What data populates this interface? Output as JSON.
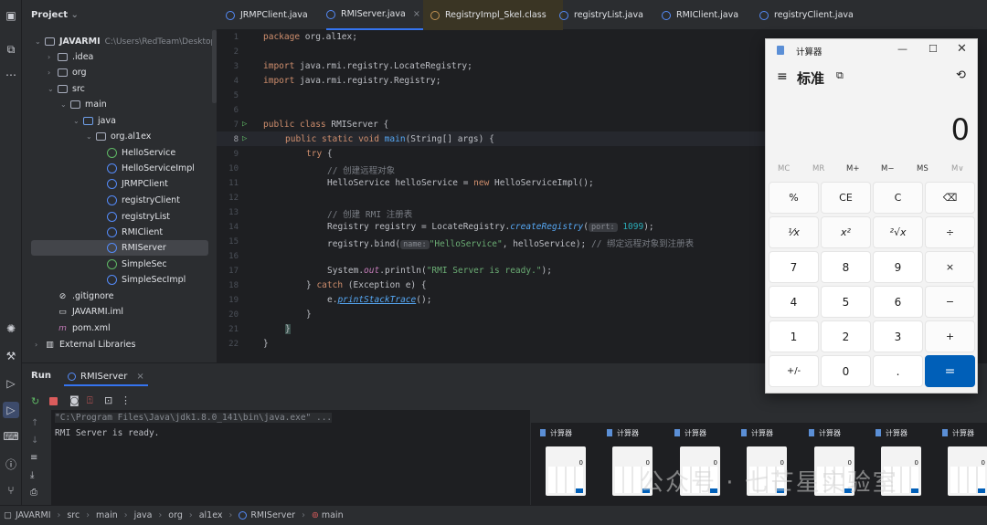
{
  "project": {
    "header": "Project",
    "tree": [
      {
        "label": "JAVARMI",
        "sub": "C:\\Users\\RedTeam\\Desktop\\De",
        "kind": "folder"
      },
      {
        "label": ".idea",
        "kind": "folder"
      },
      {
        "label": "org",
        "kind": "folder"
      },
      {
        "label": "src",
        "kind": "folder"
      },
      {
        "label": "main",
        "kind": "folder"
      },
      {
        "label": "java",
        "kind": "folder"
      },
      {
        "label": "org.al1ex",
        "kind": "package"
      },
      {
        "label": "HelloService",
        "kind": "class"
      },
      {
        "label": "HelloServiceImpl",
        "kind": "class"
      },
      {
        "label": "JRMPClient",
        "kind": "class"
      },
      {
        "label": "registryClient",
        "kind": "class"
      },
      {
        "label": "registryList",
        "kind": "class"
      },
      {
        "label": "RMIClient",
        "kind": "class"
      },
      {
        "label": "RMIServer",
        "kind": "class"
      },
      {
        "label": "SimpleSec",
        "kind": "class"
      },
      {
        "label": "SimpleSecImpl",
        "kind": "class"
      },
      {
        "label": ".gitignore",
        "kind": "file"
      },
      {
        "label": "JAVARMI.iml",
        "kind": "file"
      },
      {
        "label": "pom.xml",
        "kind": "file"
      },
      {
        "label": "External Libraries",
        "kind": "lib"
      }
    ]
  },
  "tabs": [
    "JRMPClient.java",
    "RMIServer.java",
    "RegistryImpl_Skel.class",
    "registryList.java",
    "RMIClient.java",
    "registryClient.java"
  ],
  "editor": {
    "line_numbers": [
      "1",
      "2",
      "3",
      "4",
      "5",
      "6",
      "7",
      "8",
      "9",
      "10",
      "11",
      "12",
      "13",
      "14",
      "15",
      "16",
      "17",
      "18",
      "19",
      "20",
      "21",
      "22"
    ],
    "code": {
      "l1_kw": "package",
      "l1_rest": " org.al1ex;",
      "l3_kw": "import",
      "l3_rest": " java.rmi.registry.LocateRegistry;",
      "l4_kw": "import",
      "l4_rest": " java.rmi.registry.Registry;",
      "l7_kw": "public class",
      "l7_rest": " RMIServer {",
      "l8_kw": "public static void",
      "l8_fn": " main",
      "l8_rest": "(String[] args) {",
      "l9_kw": "try",
      "l9_rest": " {",
      "l10_cm": "// 创建远程对象",
      "l11_a": "HelloService helloService = ",
      "l11_kw": "new",
      "l11_b": " HelloServiceImpl();",
      "l13_cm": "// 创建 RMI 注册表",
      "l14_a": "Registry registry = LocateRegistry.",
      "l14_fn": "createRegistry",
      "l14_b": "(",
      "l14_hint": "port:",
      "l14_num": " 1099",
      "l14_c": ");",
      "l15_a": "registry.bind(",
      "l15_hint": "name:",
      "l15_str": "\"HelloService\"",
      "l15_b": ", helloService); ",
      "l15_cm": "// 绑定远程对象到注册表",
      "l17_a": "System.",
      "l17_fld": "out",
      "l17_b": ".println(",
      "l17_str": "\"RMI Server is ready.\"",
      "l17_c": ");",
      "l18_a": "} ",
      "l18_kw": "catch",
      "l18_b": " (Exception e) {",
      "l19_a": "e.",
      "l19_fn": "printStackTrace",
      "l19_b": "();",
      "l20": "}",
      "l21": "}",
      "l22": "}"
    }
  },
  "run": {
    "label": "Run",
    "tab": "RMIServer",
    "console": [
      "\"C:\\Program Files\\Java\\jdk1.8.0_141\\bin\\java.exe\" ...",
      "RMI Server is ready."
    ]
  },
  "status_bar": [
    "JAVARMI",
    "src",
    "main",
    "java",
    "org",
    "al1ex",
    "RMIServer",
    "main"
  ],
  "calculator": {
    "title": "计算器",
    "mode": "标准",
    "display": "0",
    "memory": [
      "MC",
      "MR",
      "M+",
      "M−",
      "MS",
      "M∨"
    ],
    "keys": [
      "%",
      "CE",
      "C",
      "⌫",
      "¹⁄x",
      "x²",
      "²√x",
      "÷",
      "7",
      "8",
      "9",
      "×",
      "4",
      "5",
      "6",
      "−",
      "1",
      "2",
      "3",
      "+",
      "+/-",
      "0",
      ".",
      "="
    ]
  },
  "thumbnails": {
    "title": "计算器",
    "display": "0",
    "count": 7
  },
  "watermark": "公众号 · 七芒星实验室",
  "colors": {
    "accent": "#3574f0",
    "calc_equals": "#005fb8",
    "run_green": "#5fb865"
  }
}
